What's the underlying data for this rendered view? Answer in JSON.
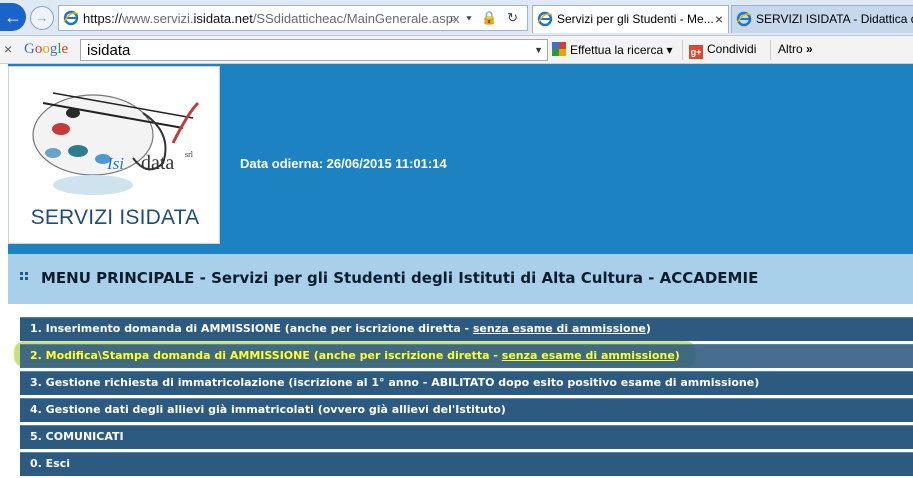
{
  "browser": {
    "url_scheme": "https://",
    "url_sub": "www.servizi.",
    "url_domain": "isidata.net",
    "url_path": "/SSdidatticheac/MainGenerale.aspx",
    "url_controls": "⌕ ▾ 🔒 ↻",
    "tabs": [
      {
        "label": "Servizi per gli Studenti - Me...",
        "active": true
      },
      {
        "label": "SERVIZI ISIDATA - Didattica de",
        "active": false
      }
    ]
  },
  "google_toolbar": {
    "logo": "Google",
    "search_value": "isidata",
    "search_button": "Effettua la ricerca",
    "share_button": "Condividi",
    "more_button": "Altro"
  },
  "header": {
    "logo_word": "data",
    "logo_brand": "Isi",
    "logo_srl": "srl",
    "logo_title": "SERVIZI ISIDATA",
    "date_label": "Data odierna: 26/06/2015 11:01:14"
  },
  "menu": {
    "title": "MENU PRINCIPALE - Servizi per gli Studenti degli Istituti di Alta Cultura - ACCADEMIE",
    "items": [
      {
        "prefix": "1. Inserimento domanda di AMMISSIONE (anche per iscrizione diretta - ",
        "link": "senza esame di ammissione",
        "suffix": ")"
      },
      {
        "prefix": "2. Modifica\\Stampa domanda di AMMISSIONE (anche per iscrizione diretta - ",
        "link": "senza esame di ammissione",
        "suffix": ")"
      },
      {
        "prefix": "3. Gestione richiesta di immatricolazione (iscrizione al 1° anno - ABILITATO dopo esito positivo esame di ammissione)",
        "link": "",
        "suffix": ""
      },
      {
        "prefix": "4. Gestione dati degli allievi già immatricolati (ovvero già allievi del'Istituto)",
        "link": "",
        "suffix": ""
      },
      {
        "prefix": "5. COMUNICATI",
        "link": "",
        "suffix": ""
      },
      {
        "prefix": "0. Esci",
        "link": "",
        "suffix": ""
      }
    ]
  },
  "colors": {
    "header_blue": "#1c82c2",
    "menu_head_bg": "#a9d0ea",
    "menu_item_bg": "#2d5a80",
    "highlight_text": "#ffff33",
    "marker_green": "#96c814"
  }
}
